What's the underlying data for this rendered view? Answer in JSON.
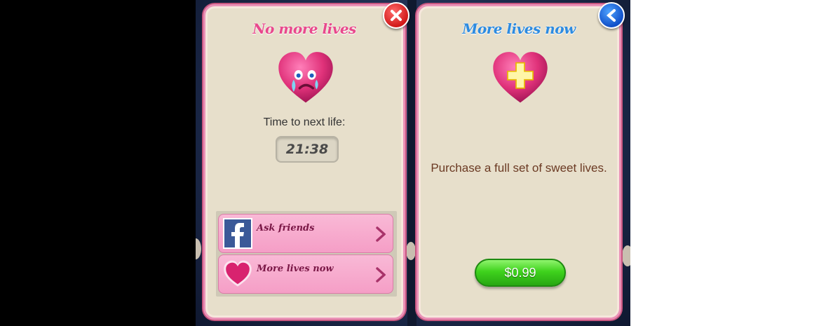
{
  "left_panel": {
    "title": "No more lives",
    "time_label": "Time to next life:",
    "timer": "21:38",
    "options": [
      {
        "label": "Ask friends",
        "icon": "facebook-icon"
      },
      {
        "label": "More lives now",
        "icon": "heart-icon"
      }
    ]
  },
  "right_panel": {
    "title": "More lives now",
    "description": "Purchase a full set of sweet lives.",
    "price": "$0.99"
  },
  "colors": {
    "panel_bg": "#e7dfcb",
    "title_pink": "#e8498c",
    "title_blue": "#2d8be0",
    "heart": "#e0327a",
    "price_button": "#3fd21d",
    "close_button": "#d11919",
    "back_button": "#104fc8"
  }
}
